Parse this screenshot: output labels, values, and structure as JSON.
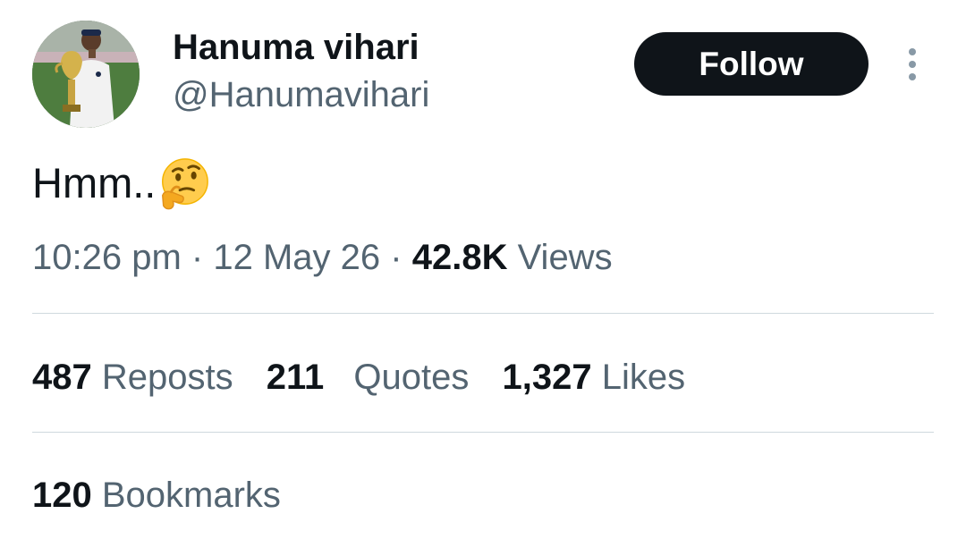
{
  "user": {
    "display_name": "Hanuma vihari",
    "handle": "@Hanumavihari"
  },
  "actions": {
    "follow_label": "Follow",
    "more_icon": "more-vertical-icon"
  },
  "tweet": {
    "text": "Hmm..",
    "emoji_icon": "thinking-face-emoji"
  },
  "meta": {
    "time": "10:26 pm",
    "separator": "·",
    "date": "12 May 26",
    "views_count": "42.8K",
    "views_label": "Views"
  },
  "stats": {
    "reposts_count": "487",
    "reposts_label": "Reposts",
    "quotes_count": "211",
    "quotes_label": "Quotes",
    "likes_count": "1,327",
    "likes_label": "Likes",
    "bookmarks_count": "120",
    "bookmarks_label": "Bookmarks"
  },
  "colors": {
    "text_primary": "#0f1419",
    "text_secondary": "#536471",
    "divider": "#cfd9de",
    "button_bg": "#0f1419",
    "button_text": "#ffffff"
  }
}
